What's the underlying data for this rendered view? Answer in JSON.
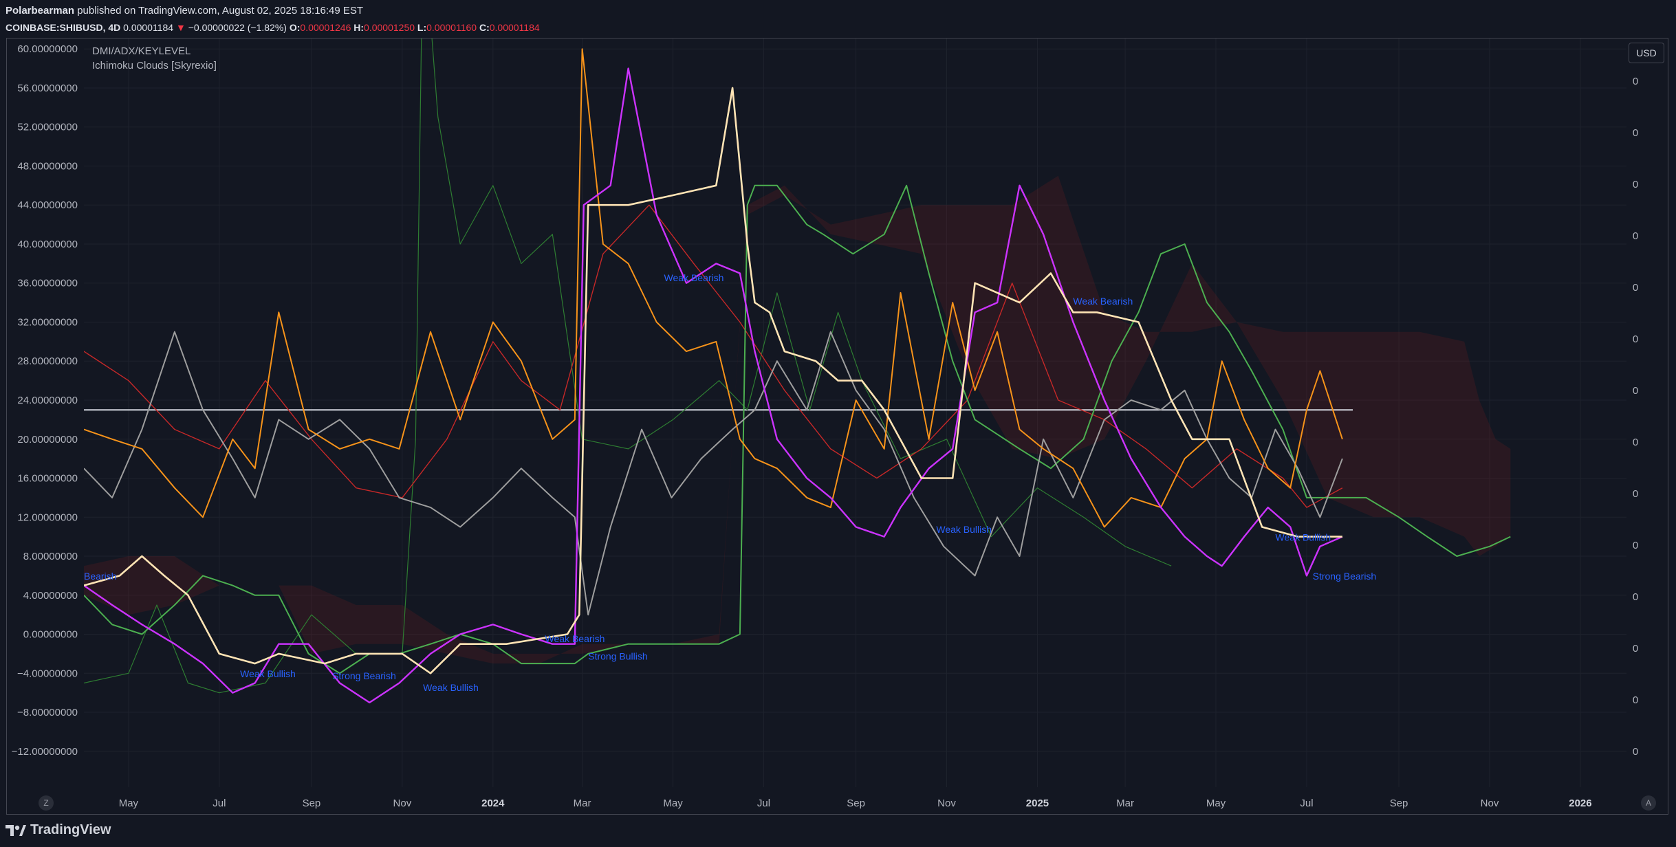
{
  "header": {
    "author": "Polarbearman",
    "published_text": "published on TradingView.com, August 02, 2025 18:16:49 EST",
    "symbol": "COINBASE:SHIBUSD, 4D",
    "last": "0.00001184",
    "change": "−0.00000022 (−1.82%)",
    "open_label": "O:",
    "open": "0.00001246",
    "high_label": "H:",
    "high": "0.00001250",
    "low_label": "L:",
    "low": "0.00001160",
    "close_label": "C:",
    "close": "0.00001184"
  },
  "legend": {
    "line1": "DMI/ADX/KEYLEVEL",
    "line2": "Ichimoku Clouds [Skyrexio]"
  },
  "currency_button": "USD",
  "footer": {
    "brand": "TradingView"
  },
  "buttons": {
    "left": "Z",
    "right": "A"
  },
  "colors": {
    "background": "#131722",
    "plus_di": "#26a69a",
    "orange": "#f7931a",
    "purple": "#cc33ff",
    "cream": "#ffe4b5",
    "gray": "#9e9e9e",
    "green": "#4caf50",
    "red": "#c62828",
    "label_blue": "#2962ff"
  },
  "chart_data": {
    "type": "line",
    "x_ticks": [
      "May",
      "Jul",
      "Sep",
      "Nov",
      "2024",
      "Mar",
      "May",
      "Jul",
      "Sep",
      "Nov",
      "2025",
      "Mar",
      "May",
      "Jul",
      "Sep",
      "Nov",
      "2026"
    ],
    "y_ticks": [
      "60.00000000",
      "56.00000000",
      "52.00000000",
      "48.00000000",
      "44.00000000",
      "40.00000000",
      "36.00000000",
      "32.00000000",
      "28.00000000",
      "24.00000000",
      "20.00000000",
      "16.00000000",
      "12.00000000",
      "8.00000000",
      "4.00000000",
      "0.00000000",
      "−4.00000000",
      "−8.00000000",
      "−12.00000000"
    ],
    "ylim": [
      -13,
      61
    ],
    "right_ticks": [
      "0",
      "0",
      "0",
      "0",
      "0",
      "0",
      "0",
      "0",
      "0",
      "0",
      "0",
      "0",
      "0",
      "0"
    ],
    "key_level": 23,
    "x_start": "2023-04-01",
    "x_end": "2026-02-01",
    "series": [
      {
        "color": "#f7931a",
        "x": [
          "2023-04-01",
          "2023-04-20",
          "2023-05-10",
          "2023-06-01",
          "2023-06-20",
          "2023-07-10",
          "2023-07-25",
          "2023-08-10",
          "2023-08-30",
          "2023-09-20",
          "2023-10-10",
          "2023-10-30",
          "2023-11-20",
          "2023-12-10",
          "2024-01-01",
          "2024-01-20",
          "2024-02-10",
          "2024-02-25",
          "2024-03-01",
          "2024-03-15",
          "2024-04-01",
          "2024-04-20",
          "2024-05-10",
          "2024-05-30",
          "2024-06-15",
          "2024-06-25",
          "2024-07-10",
          "2024-07-30",
          "2024-08-15",
          "2024-09-01",
          "2024-09-20",
          "2024-10-01",
          "2024-10-20",
          "2024-11-05",
          "2024-11-20",
          "2024-12-05",
          "2024-12-20",
          "2025-01-05",
          "2025-01-25",
          "2025-02-15",
          "2025-03-05",
          "2025-03-25",
          "2025-04-10",
          "2025-04-25",
          "2025-05-05",
          "2025-05-20",
          "2025-06-05",
          "2025-06-20",
          "2025-07-01",
          "2025-07-10",
          "2025-07-25"
        ],
        "y": [
          21,
          20,
          19,
          15,
          12,
          20,
          17,
          33,
          21,
          19,
          20,
          19,
          31,
          22,
          32,
          28,
          20,
          22,
          60,
          40,
          38,
          32,
          29,
          30,
          20,
          18,
          17,
          14,
          13,
          24,
          19,
          35,
          20,
          34,
          25,
          31,
          21,
          19,
          17,
          11,
          14,
          13,
          18,
          20,
          28,
          22,
          17,
          15,
          23,
          27,
          20
        ]
      },
      {
        "color": "#cc33ff",
        "x": [
          "2023-04-01",
          "2023-04-20",
          "2023-05-10",
          "2023-06-01",
          "2023-06-20",
          "2023-07-10",
          "2023-07-25",
          "2023-08-10",
          "2023-08-30",
          "2023-09-20",
          "2023-10-10",
          "2023-10-30",
          "2023-11-20",
          "2023-12-10",
          "2024-01-01",
          "2024-01-20",
          "2024-02-10",
          "2024-02-25",
          "2024-03-02",
          "2024-03-20",
          "2024-04-01",
          "2024-04-20",
          "2024-05-10",
          "2024-05-30",
          "2024-06-15",
          "2024-06-25",
          "2024-07-10",
          "2024-07-30",
          "2024-08-15",
          "2024-09-01",
          "2024-09-20",
          "2024-10-01",
          "2024-10-20",
          "2024-11-05",
          "2024-11-20",
          "2024-12-05",
          "2024-12-20",
          "2025-01-05",
          "2025-01-25",
          "2025-02-15",
          "2025-03-05",
          "2025-03-25",
          "2025-04-10",
          "2025-04-25",
          "2025-05-05",
          "2025-05-20",
          "2025-06-05",
          "2025-06-20",
          "2025-07-01",
          "2025-07-10",
          "2025-07-25"
        ],
        "y": [
          5,
          3,
          1,
          -1,
          -3,
          -6,
          -5,
          -1,
          -1,
          -5,
          -7,
          -5,
          -2,
          0,
          1,
          0,
          -1,
          -1,
          44,
          46,
          58,
          43,
          36,
          38,
          37,
          29,
          20,
          16,
          14,
          11,
          10,
          13,
          17,
          19,
          33,
          34,
          46,
          41,
          32,
          24,
          18,
          13,
          10,
          8,
          7,
          10,
          13,
          11,
          6,
          9,
          10
        ]
      },
      {
        "color": "#ffe4b5",
        "x": [
          "2023-04-01",
          "2023-04-25",
          "2023-05-10",
          "2023-05-25",
          "2023-06-10",
          "2023-07-01",
          "2023-07-25",
          "2023-08-10",
          "2023-09-10",
          "2023-10-01",
          "2023-11-01",
          "2023-11-20",
          "2023-12-10",
          "2024-01-10",
          "2024-02-20",
          "2024-02-28",
          "2024-03-05",
          "2024-04-01",
          "2024-05-01",
          "2024-05-30",
          "2024-06-10",
          "2024-06-20",
          "2024-06-25",
          "2024-07-05",
          "2024-07-15",
          "2024-08-05",
          "2024-08-20",
          "2024-09-05",
          "2024-09-20",
          "2024-10-15",
          "2024-11-05",
          "2024-11-20",
          "2024-12-20",
          "2025-01-10",
          "2025-01-25",
          "2025-02-10",
          "2025-03-10",
          "2025-04-01",
          "2025-04-15",
          "2025-05-10",
          "2025-06-01",
          "2025-06-25",
          "2025-07-25"
        ],
        "y": [
          5,
          6,
          8,
          6,
          4,
          -2,
          -3,
          -2,
          -3,
          -2,
          -2,
          -4,
          -1,
          -1,
          0,
          2,
          44,
          44,
          45,
          46,
          56,
          40,
          34,
          33,
          29,
          28,
          26,
          26,
          23,
          16,
          16,
          36,
          34,
          37,
          33,
          33,
          32,
          24,
          20,
          20,
          11,
          10,
          10
        ]
      },
      {
        "color": "#9e9e9e",
        "x": [
          "2023-04-01",
          "2023-04-20",
          "2023-05-10",
          "2023-06-01",
          "2023-06-20",
          "2023-07-10",
          "2023-07-25",
          "2023-08-10",
          "2023-08-30",
          "2023-09-20",
          "2023-10-10",
          "2023-10-30",
          "2023-11-20",
          "2023-12-10",
          "2024-01-01",
          "2024-01-20",
          "2024-02-10",
          "2024-02-25",
          "2024-03-05",
          "2024-03-20",
          "2024-04-10",
          "2024-04-30",
          "2024-05-20",
          "2024-06-10",
          "2024-06-25",
          "2024-07-10",
          "2024-07-30",
          "2024-08-15",
          "2024-09-01",
          "2024-09-20",
          "2024-10-10",
          "2024-10-30",
          "2024-11-20",
          "2024-12-05",
          "2024-12-20",
          "2025-01-05",
          "2025-01-25",
          "2025-02-15",
          "2025-03-05",
          "2025-03-25",
          "2025-04-10",
          "2025-04-25",
          "2025-05-10",
          "2025-05-25",
          "2025-06-10",
          "2025-06-25",
          "2025-07-10",
          "2025-07-25"
        ],
        "y": [
          17,
          14,
          21,
          31,
          23,
          18,
          14,
          22,
          20,
          22,
          19,
          14,
          13,
          11,
          14,
          17,
          14,
          12,
          2,
          11,
          21,
          14,
          18,
          21,
          23,
          28,
          23,
          31,
          25,
          21,
          14,
          9,
          6,
          12,
          8,
          20,
          14,
          22,
          24,
          23,
          25,
          20,
          16,
          14,
          21,
          17,
          12,
          18
        ]
      },
      {
        "color": "#4caf50",
        "x": [
          "2023-04-01",
          "2023-04-20",
          "2023-05-10",
          "2023-06-01",
          "2023-06-20",
          "2023-07-10",
          "2023-07-25",
          "2023-08-10",
          "2023-08-30",
          "2023-09-20",
          "2023-10-10",
          "2023-10-30",
          "2023-11-20",
          "2023-12-10",
          "2024-01-01",
          "2024-01-20",
          "2024-02-10",
          "2024-02-25",
          "2024-03-05",
          "2024-04-01",
          "2024-05-01",
          "2024-06-01",
          "2024-06-15",
          "2024-06-20",
          "2024-06-25",
          "2024-07-10",
          "2024-07-30",
          "2024-08-10",
          "2024-08-30",
          "2024-09-20",
          "2024-10-05",
          "2024-10-20",
          "2024-11-05",
          "2024-11-20",
          "2024-12-20",
          "2025-01-10",
          "2025-02-01",
          "2025-02-20",
          "2025-03-10",
          "2025-03-25",
          "2025-04-10",
          "2025-04-25",
          "2025-05-10",
          "2025-05-25",
          "2025-06-15",
          "2025-07-01",
          "2025-07-20",
          "2025-08-10",
          "2025-09-01",
          "2025-09-20",
          "2025-10-10",
          "2025-11-01",
          "2025-11-15"
        ],
        "y": [
          4,
          1,
          0,
          3,
          6,
          5,
          4,
          4,
          -2,
          -4,
          -2,
          -2,
          -1,
          0,
          -1,
          -3,
          -3,
          -3,
          -2,
          -1,
          -1,
          -1,
          0,
          44,
          46,
          46,
          42,
          41,
          39,
          41,
          46,
          37,
          28,
          22,
          19,
          17,
          20,
          28,
          33,
          39,
          40,
          34,
          31,
          27,
          21,
          14,
          14,
          14,
          12,
          10,
          8,
          9,
          10
        ]
      },
      {
        "color": "#c62828",
        "x": [
          "2023-04-01",
          "2023-05-01",
          "2023-06-01",
          "2023-07-01",
          "2023-08-01",
          "2023-09-01",
          "2023-10-01",
          "2023-11-01",
          "2023-12-01",
          "2024-01-01",
          "2024-01-20",
          "2024-02-15",
          "2024-03-15",
          "2024-04-15",
          "2024-05-15",
          "2024-06-15",
          "2024-07-15",
          "2024-08-15",
          "2024-09-15",
          "2024-10-15",
          "2024-11-15",
          "2024-12-15",
          "2025-01-15",
          "2025-02-15",
          "2025-03-15",
          "2025-04-15",
          "2025-05-15",
          "2025-06-15",
          "2025-07-01",
          "2025-07-25"
        ],
        "y": [
          29,
          26,
          21,
          19,
          26,
          20,
          15,
          14,
          20,
          30,
          26,
          23,
          39,
          44,
          38,
          32,
          25,
          19,
          16,
          19,
          24,
          36,
          24,
          22,
          19,
          15,
          19,
          16,
          13,
          15
        ]
      },
      {
        "color": "#2e7d32",
        "x": [
          "2023-04-01",
          "2023-05-01",
          "2023-05-20",
          "2023-06-10",
          "2023-07-01",
          "2023-08-01",
          "2023-09-01",
          "2023-10-01",
          "2023-11-01",
          "2023-11-10",
          "2023-11-15",
          "2023-11-25",
          "2023-12-10",
          "2024-01-01",
          "2024-01-20",
          "2024-02-10",
          "2024-03-01",
          "2024-04-01",
          "2024-05-01",
          "2024-06-01",
          "2024-06-20",
          "2024-07-10",
          "2024-08-01",
          "2024-08-20",
          "2024-09-05",
          "2024-10-01",
          "2024-11-01",
          "2024-12-01",
          "2025-01-01",
          "2025-02-01",
          "2025-03-01",
          "2025-04-01"
        ],
        "y": [
          -5,
          -4,
          3,
          -5,
          -6,
          -5,
          2,
          -2,
          -2,
          20,
          73,
          53,
          40,
          46,
          38,
          41,
          20,
          19,
          22,
          26,
          23,
          35,
          23,
          33,
          26,
          18,
          20,
          10,
          15,
          12,
          9,
          7
        ]
      }
    ],
    "cloud": {
      "upper": {
        "x": [
          "2023-04-01",
          "2023-05-01",
          "2023-06-01",
          "2023-07-01",
          "2023-08-10",
          "2023-09-01",
          "2023-10-01",
          "2023-11-01",
          "2023-12-01",
          "2024-01-01",
          "2024-02-01",
          "2024-03-01",
          "2024-04-01",
          "2024-05-01",
          "2024-06-01",
          "2024-06-20",
          "2024-07-15",
          "2024-08-15",
          "2024-09-15",
          "2024-10-15",
          "2024-11-15",
          "2024-12-15",
          "2025-01-15",
          "2025-02-15",
          "2025-03-15",
          "2025-04-15",
          "2025-05-15",
          "2025-06-15",
          "2025-07-15",
          "2025-08-15",
          "2025-09-15",
          "2025-10-15",
          "2025-10-25",
          "2025-11-05",
          "2025-11-15"
        ],
        "y": [
          7,
          8,
          8,
          5,
          5,
          5,
          3,
          3,
          0,
          -2,
          -2,
          -2,
          -1,
          -1,
          0,
          43,
          45,
          42,
          43,
          44,
          44,
          44,
          47,
          33,
          31,
          31,
          32,
          31,
          31,
          31,
          31,
          30,
          24,
          20,
          19
        ]
      },
      "lower": {
        "x": [
          "2023-04-01",
          "2023-05-01",
          "2023-06-01",
          "2023-07-01",
          "2023-08-10",
          "2023-09-01",
          "2023-10-01",
          "2023-11-01",
          "2023-12-01",
          "2024-01-01",
          "2024-02-01",
          "2024-03-01",
          "2024-04-01",
          "2024-05-01",
          "2024-06-01",
          "2024-06-20",
          "2024-07-15",
          "2024-08-15",
          "2024-09-15",
          "2024-10-15",
          "2024-11-15",
          "2024-12-15",
          "2025-01-15",
          "2025-02-15",
          "2025-03-15",
          "2025-04-15",
          "2025-05-15",
          "2025-06-15",
          "2025-07-15",
          "2025-08-15",
          "2025-09-15",
          "2025-10-15",
          "2025-10-25",
          "2025-11-05",
          "2025-11-15"
        ],
        "y": [
          4,
          2,
          3,
          5,
          5,
          -2,
          -1,
          -1,
          -2,
          -3,
          -3,
          -1,
          -1,
          -1,
          -1,
          44,
          46,
          41,
          40,
          39,
          27,
          19,
          18,
          20,
          28,
          38,
          32,
          24,
          14,
          12,
          12,
          10,
          8,
          9,
          10
        ]
      }
    },
    "annotations": [
      {
        "text": "Bearish",
        "x": "2023-04-01",
        "y": 5.6
      },
      {
        "text": "Weak Bullish",
        "x": "2023-07-15",
        "y": -4.4
      },
      {
        "text": "Strong Bearish",
        "x": "2023-09-15",
        "y": -4.6
      },
      {
        "text": "Weak Bullish",
        "x": "2023-11-15",
        "y": -5.8
      },
      {
        "text": "Weak Bearish",
        "x": "2024-02-05",
        "y": -0.8
      },
      {
        "text": "Strong Bullish",
        "x": "2024-03-05",
        "y": -2.6
      },
      {
        "text": "Weak Bearish",
        "x": "2024-04-25",
        "y": 36.2
      },
      {
        "text": "Weak Bullish",
        "x": "2024-10-25",
        "y": 10.4
      },
      {
        "text": "Weak Bearish",
        "x": "2025-01-25",
        "y": 33.8
      },
      {
        "text": "Weak Bullish",
        "x": "2025-06-10",
        "y": 9.6
      },
      {
        "text": "Strong Bearish",
        "x": "2025-07-05",
        "y": 5.6
      }
    ]
  }
}
